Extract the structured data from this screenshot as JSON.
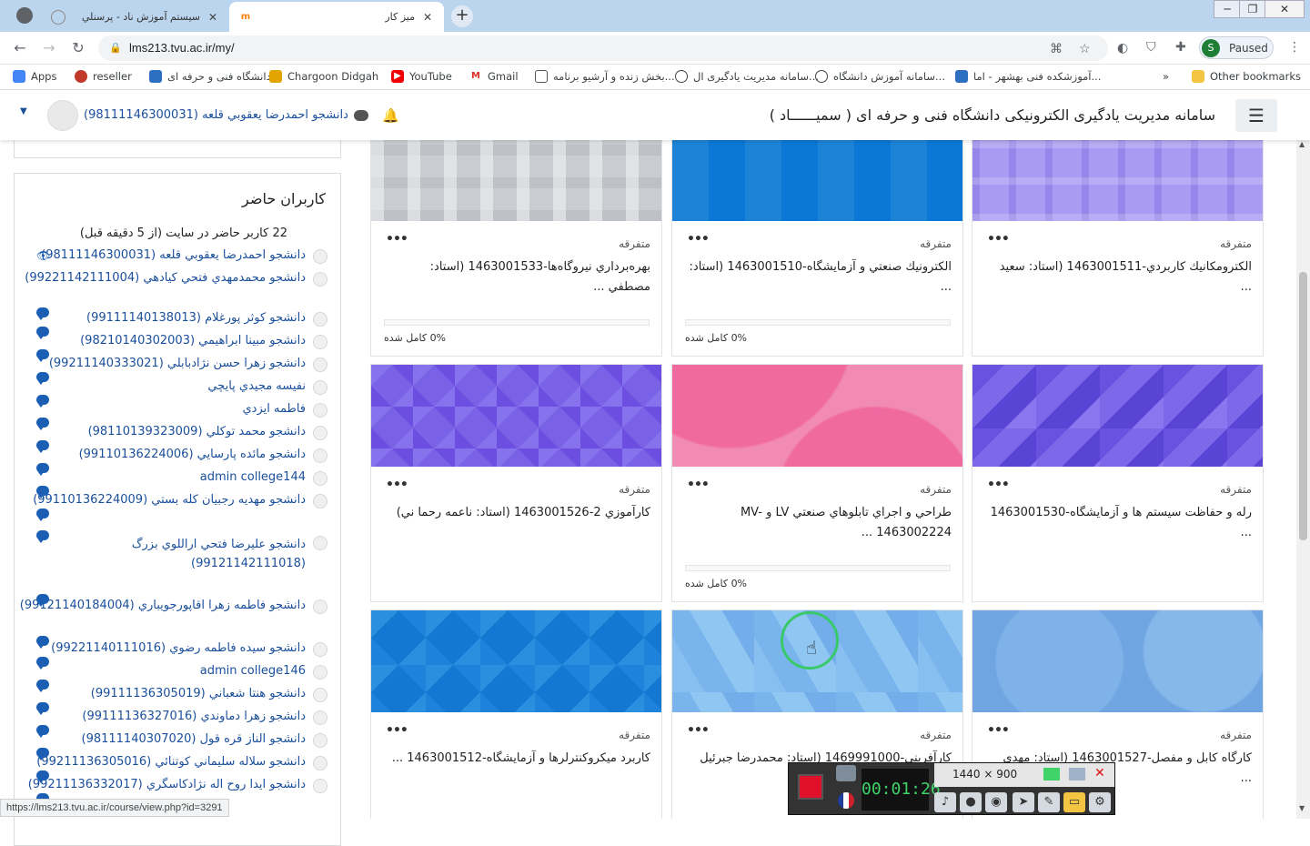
{
  "browser": {
    "tabs": [
      {
        "title": "سیستم آموزش ناد - پرسنلي",
        "active": false
      },
      {
        "title": "میز کار",
        "active": true
      }
    ],
    "url": "lms213.tvu.ac.ir/my/",
    "profile_status": "Paused",
    "profile_initial": "S",
    "bookmarks": [
      {
        "label": "Apps",
        "icon": "apps-grid-icon"
      },
      {
        "label": "reseller",
        "icon": "fruit-icon"
      },
      {
        "label": "دانشگاه فنی و حرفه ای",
        "icon": "tvu-logo-icon"
      },
      {
        "label": "Chargoon Didgah",
        "icon": "chargoon-icon"
      },
      {
        "label": "YouTube",
        "icon": "youtube-icon"
      },
      {
        "label": "Gmail",
        "icon": "gmail-icon"
      },
      {
        "label": "بخش زنده و آرشیو برنامه...",
        "icon": "archive-icon"
      },
      {
        "label": "سامانه مدیریت یادگیری ال...",
        "icon": "globe-icon"
      },
      {
        "label": "سامانه آموزش دانشگاه...",
        "icon": "globe-icon"
      },
      {
        "label": "آموزشکده فنی بهشهر - اما...",
        "icon": "tvu-logo-icon"
      },
      {
        "label": "Other bookmarks",
        "icon": "folder-icon"
      }
    ],
    "status_url": "https://lms213.tvu.ac.ir/course/view.php?id=3291"
  },
  "header": {
    "site_name": "سامانه مدیریت یادگیری الکترونیکی دانشگاه فنی و حرفه ای ( سمیــــــاد )",
    "user_name": "دانشجو احمدرضا يعقوبي قلعه (98111146300031)"
  },
  "online_users": {
    "title": "کاربران حاضر",
    "summary": "22 کاربر حاضر در سایت (از 5 دقیقه قبل)",
    "users": [
      {
        "name": "دانشجو احمدرضا يعقوبي قلعه (98111146300031)",
        "icon": "eye-icon"
      },
      {
        "name": "دانشجو محمدمهدي فتحي كيادهي (99221142111004)",
        "icon": "message-icon"
      },
      {
        "name": "دانشجو كوثر پورغلام (99111140138013)",
        "icon": "message-icon"
      },
      {
        "name": "دانشجو مبينا ابراهيمي (98210140302003)",
        "icon": "message-icon"
      },
      {
        "name": "دانشجو زهرا حسن نژادبابلي (99211140333021)",
        "icon": "message-icon"
      },
      {
        "name": "نفيسه مجيدي پايچي",
        "icon": "message-icon"
      },
      {
        "name": "فاطمه ايزدي",
        "icon": "message-icon"
      },
      {
        "name": "دانشجو محمد توكلي (98110139323009)",
        "icon": "message-icon"
      },
      {
        "name": "دانشجو مائده پارسايي (99110136224006)",
        "icon": "message-icon"
      },
      {
        "name": "admin college144",
        "icon": "message-icon"
      },
      {
        "name": "دانشجو مهديه رجبيان كله بستي (99110136224009)",
        "icon": "message-icon"
      },
      {
        "name": "دانشجو عليرضا فتحي اراللوي بزرگ (99121142111018)",
        "icon": "message-icon"
      },
      {
        "name": "دانشجو فاطمه زهرا اقاپورجويباري (99121140184004)",
        "icon": "message-icon"
      },
      {
        "name": "دانشجو سيده فاطمه رضوي (99221140111016)",
        "icon": "message-icon"
      },
      {
        "name": "admin college146",
        "icon": "message-icon"
      },
      {
        "name": "دانشجو هنتا شعباني (99111136305019)",
        "icon": "message-icon"
      },
      {
        "name": "دانشجو زهرا دماوندي (99111136327016)",
        "icon": "message-icon"
      },
      {
        "name": "دانشجو الناز قره قول (98111140307020)",
        "icon": "message-icon"
      },
      {
        "name": "دانشجو سلاله سليماني كوتنائي (99211136305016)",
        "icon": "message-icon"
      },
      {
        "name": "دانشجو ايدا روح اله نژادكاسگري (99211136332017)",
        "icon": "message-icon"
      }
    ]
  },
  "courses": [
    {
      "category": "متفرقه",
      "name": "الكترومكانيك كاربردي-1463001511 (استاد: سعيد ...",
      "progress": null,
      "progress_label": "",
      "pattern": "lavender-squares"
    },
    {
      "category": "متفرقه",
      "name": "الكترونيك صنعتي و آزمايشگاه-1463001510 (استاد: ...",
      "progress": 0,
      "progress_label": "0% كامل شده",
      "pattern": "blue-squares"
    },
    {
      "category": "متفرقه",
      "name": "بهره‌برداري نيروگاه‌ها-1463001533 (استاد: مصطفي ...",
      "progress": 0,
      "progress_label": "0% كامل شده",
      "pattern": "grey-plaid"
    },
    {
      "category": "متفرقه",
      "name": "رله و حفاظت سيستم ها و آزمايشگاه-1463001530 ...",
      "progress": null,
      "progress_label": "",
      "pattern": "purple-triangles"
    },
    {
      "category": "متفرقه",
      "name": "طراحي و اجراي تابلوهاي صنعتي LV و MV-1463002224 ...",
      "progress": 0,
      "progress_label": "0% كامل شده",
      "pattern": "pink-waves"
    },
    {
      "category": "متفرقه",
      "name": "كارآموزي 2-1463001526 (استاد: ناعمه رحما ني)",
      "progress": null,
      "progress_label": "",
      "pattern": "purple-diamonds"
    },
    {
      "category": "متفرقه",
      "name": "كارگاه كابل و مفصل-1463001527 (استاد: مهدي ...",
      "progress": null,
      "progress_label": "",
      "pattern": "light-blue-circles"
    },
    {
      "category": "متفرقه",
      "name": "كارآفريني-1469991000 (استاد: محمدرضا جبرئيل ...",
      "progress": null,
      "progress_label": "",
      "pattern": "light-blue-triangles"
    },
    {
      "category": "متفرقه",
      "name": "كاربرد ميكروكنترلرها و آزمايشگاه-1463001512 ...",
      "progress": null,
      "progress_label": "",
      "pattern": "blue-diamonds"
    }
  ],
  "recorder": {
    "elapsed": "00:01:26",
    "dimensions": "1440 × 900"
  },
  "colors": {
    "link": "#1a4f9c",
    "tabbar": "#bcd5ee",
    "recorder_green": "#3fd36a",
    "record_red": "#e0102a"
  }
}
